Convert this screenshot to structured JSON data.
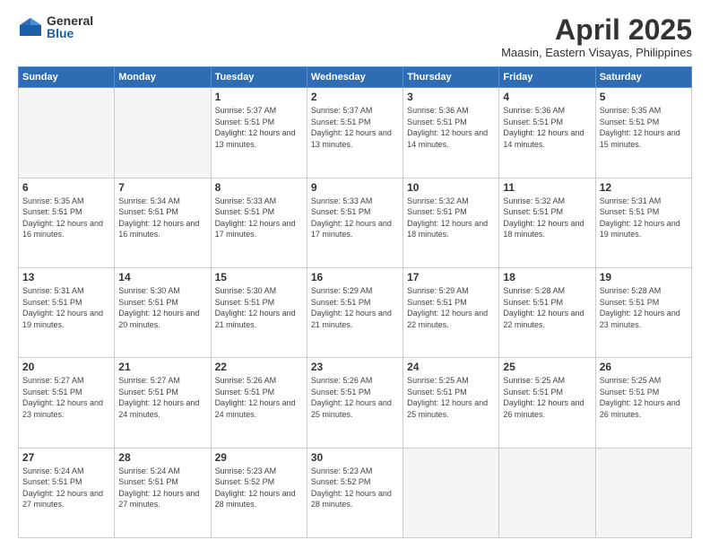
{
  "logo": {
    "general": "General",
    "blue": "Blue"
  },
  "title": "April 2025",
  "location": "Maasin, Eastern Visayas, Philippines",
  "headers": [
    "Sunday",
    "Monday",
    "Tuesday",
    "Wednesday",
    "Thursday",
    "Friday",
    "Saturday"
  ],
  "weeks": [
    [
      {
        "day": "",
        "sunrise": "",
        "sunset": "",
        "daylight": ""
      },
      {
        "day": "",
        "sunrise": "",
        "sunset": "",
        "daylight": ""
      },
      {
        "day": "1",
        "sunrise": "Sunrise: 5:37 AM",
        "sunset": "Sunset: 5:51 PM",
        "daylight": "Daylight: 12 hours and 13 minutes."
      },
      {
        "day": "2",
        "sunrise": "Sunrise: 5:37 AM",
        "sunset": "Sunset: 5:51 PM",
        "daylight": "Daylight: 12 hours and 13 minutes."
      },
      {
        "day": "3",
        "sunrise": "Sunrise: 5:36 AM",
        "sunset": "Sunset: 5:51 PM",
        "daylight": "Daylight: 12 hours and 14 minutes."
      },
      {
        "day": "4",
        "sunrise": "Sunrise: 5:36 AM",
        "sunset": "Sunset: 5:51 PM",
        "daylight": "Daylight: 12 hours and 14 minutes."
      },
      {
        "day": "5",
        "sunrise": "Sunrise: 5:35 AM",
        "sunset": "Sunset: 5:51 PM",
        "daylight": "Daylight: 12 hours and 15 minutes."
      }
    ],
    [
      {
        "day": "6",
        "sunrise": "Sunrise: 5:35 AM",
        "sunset": "Sunset: 5:51 PM",
        "daylight": "Daylight: 12 hours and 16 minutes."
      },
      {
        "day": "7",
        "sunrise": "Sunrise: 5:34 AM",
        "sunset": "Sunset: 5:51 PM",
        "daylight": "Daylight: 12 hours and 16 minutes."
      },
      {
        "day": "8",
        "sunrise": "Sunrise: 5:33 AM",
        "sunset": "Sunset: 5:51 PM",
        "daylight": "Daylight: 12 hours and 17 minutes."
      },
      {
        "day": "9",
        "sunrise": "Sunrise: 5:33 AM",
        "sunset": "Sunset: 5:51 PM",
        "daylight": "Daylight: 12 hours and 17 minutes."
      },
      {
        "day": "10",
        "sunrise": "Sunrise: 5:32 AM",
        "sunset": "Sunset: 5:51 PM",
        "daylight": "Daylight: 12 hours and 18 minutes."
      },
      {
        "day": "11",
        "sunrise": "Sunrise: 5:32 AM",
        "sunset": "Sunset: 5:51 PM",
        "daylight": "Daylight: 12 hours and 18 minutes."
      },
      {
        "day": "12",
        "sunrise": "Sunrise: 5:31 AM",
        "sunset": "Sunset: 5:51 PM",
        "daylight": "Daylight: 12 hours and 19 minutes."
      }
    ],
    [
      {
        "day": "13",
        "sunrise": "Sunrise: 5:31 AM",
        "sunset": "Sunset: 5:51 PM",
        "daylight": "Daylight: 12 hours and 19 minutes."
      },
      {
        "day": "14",
        "sunrise": "Sunrise: 5:30 AM",
        "sunset": "Sunset: 5:51 PM",
        "daylight": "Daylight: 12 hours and 20 minutes."
      },
      {
        "day": "15",
        "sunrise": "Sunrise: 5:30 AM",
        "sunset": "Sunset: 5:51 PM",
        "daylight": "Daylight: 12 hours and 21 minutes."
      },
      {
        "day": "16",
        "sunrise": "Sunrise: 5:29 AM",
        "sunset": "Sunset: 5:51 PM",
        "daylight": "Daylight: 12 hours and 21 minutes."
      },
      {
        "day": "17",
        "sunrise": "Sunrise: 5:29 AM",
        "sunset": "Sunset: 5:51 PM",
        "daylight": "Daylight: 12 hours and 22 minutes."
      },
      {
        "day": "18",
        "sunrise": "Sunrise: 5:28 AM",
        "sunset": "Sunset: 5:51 PM",
        "daylight": "Daylight: 12 hours and 22 minutes."
      },
      {
        "day": "19",
        "sunrise": "Sunrise: 5:28 AM",
        "sunset": "Sunset: 5:51 PM",
        "daylight": "Daylight: 12 hours and 23 minutes."
      }
    ],
    [
      {
        "day": "20",
        "sunrise": "Sunrise: 5:27 AM",
        "sunset": "Sunset: 5:51 PM",
        "daylight": "Daylight: 12 hours and 23 minutes."
      },
      {
        "day": "21",
        "sunrise": "Sunrise: 5:27 AM",
        "sunset": "Sunset: 5:51 PM",
        "daylight": "Daylight: 12 hours and 24 minutes."
      },
      {
        "day": "22",
        "sunrise": "Sunrise: 5:26 AM",
        "sunset": "Sunset: 5:51 PM",
        "daylight": "Daylight: 12 hours and 24 minutes."
      },
      {
        "day": "23",
        "sunrise": "Sunrise: 5:26 AM",
        "sunset": "Sunset: 5:51 PM",
        "daylight": "Daylight: 12 hours and 25 minutes."
      },
      {
        "day": "24",
        "sunrise": "Sunrise: 5:25 AM",
        "sunset": "Sunset: 5:51 PM",
        "daylight": "Daylight: 12 hours and 25 minutes."
      },
      {
        "day": "25",
        "sunrise": "Sunrise: 5:25 AM",
        "sunset": "Sunset: 5:51 PM",
        "daylight": "Daylight: 12 hours and 26 minutes."
      },
      {
        "day": "26",
        "sunrise": "Sunrise: 5:25 AM",
        "sunset": "Sunset: 5:51 PM",
        "daylight": "Daylight: 12 hours and 26 minutes."
      }
    ],
    [
      {
        "day": "27",
        "sunrise": "Sunrise: 5:24 AM",
        "sunset": "Sunset: 5:51 PM",
        "daylight": "Daylight: 12 hours and 27 minutes."
      },
      {
        "day": "28",
        "sunrise": "Sunrise: 5:24 AM",
        "sunset": "Sunset: 5:51 PM",
        "daylight": "Daylight: 12 hours and 27 minutes."
      },
      {
        "day": "29",
        "sunrise": "Sunrise: 5:23 AM",
        "sunset": "Sunset: 5:52 PM",
        "daylight": "Daylight: 12 hours and 28 minutes."
      },
      {
        "day": "30",
        "sunrise": "Sunrise: 5:23 AM",
        "sunset": "Sunset: 5:52 PM",
        "daylight": "Daylight: 12 hours and 28 minutes."
      },
      {
        "day": "",
        "sunrise": "",
        "sunset": "",
        "daylight": ""
      },
      {
        "day": "",
        "sunrise": "",
        "sunset": "",
        "daylight": ""
      },
      {
        "day": "",
        "sunrise": "",
        "sunset": "",
        "daylight": ""
      }
    ]
  ]
}
